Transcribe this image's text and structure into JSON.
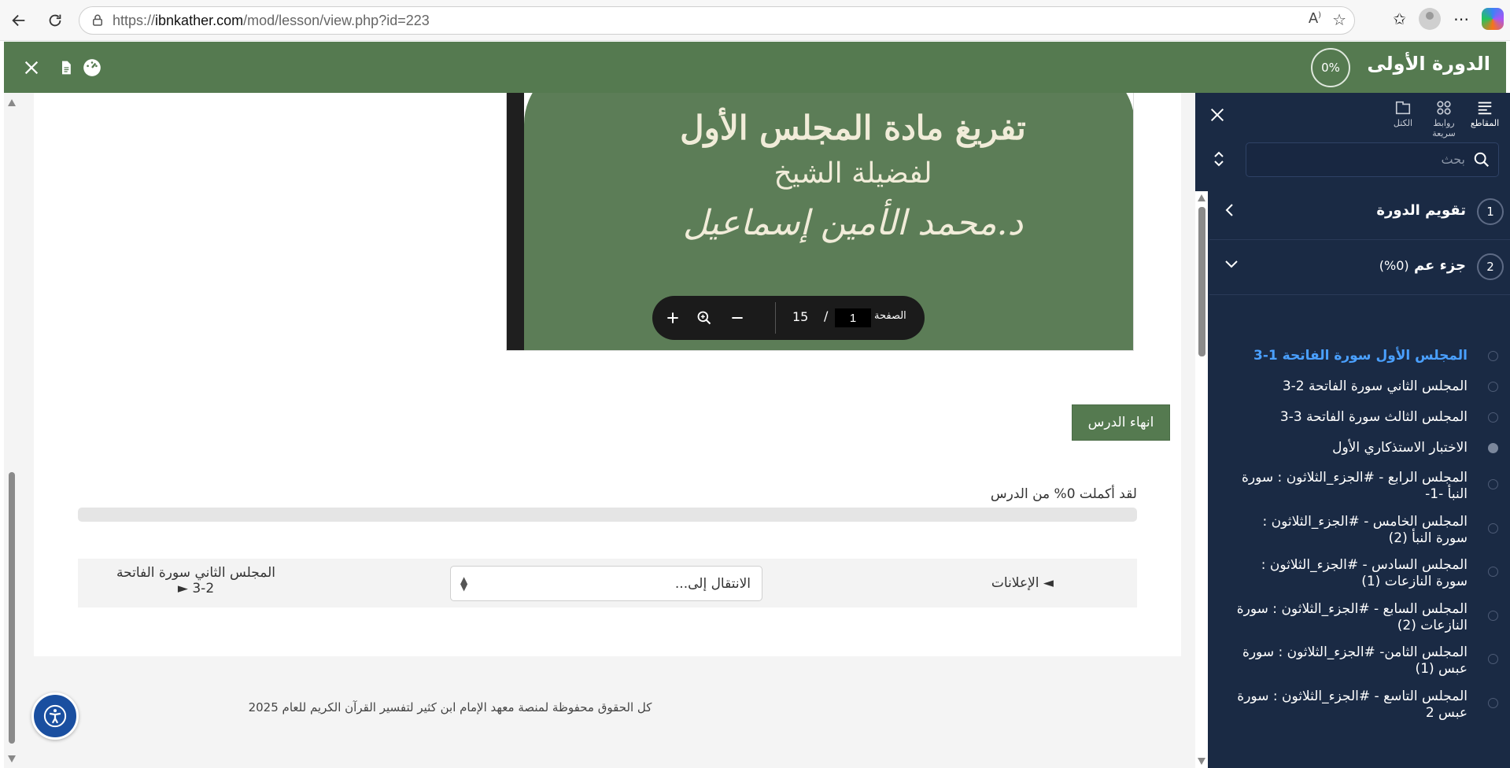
{
  "browser": {
    "url_prefix": "https://",
    "url_host": "ibnkather.com",
    "url_path": "/mod/lesson/view.php?id=223"
  },
  "header": {
    "course_title": "الدورة الأولى",
    "progress": "0%"
  },
  "pdf": {
    "line1": "تفريغ مادة المجلس الأول",
    "line2": "لفضيلة الشيخ",
    "line3": "د.محمد الأمين إسماعيل",
    "page_label": "الصفحة",
    "current_page": "1",
    "slash": "/",
    "total_pages": "15"
  },
  "lesson": {
    "finish_label": "انهاء الدرس",
    "completed_text": "لقد أكملت 0% من الدرس",
    "completed_percent": 0,
    "announcements_link": "◄ الإعلانات",
    "jump_placeholder": "الانتقال إلى...",
    "next_link": "المجلس الثاني سورة الفاتحة 2-3 ►"
  },
  "footer": {
    "copyright": "كل الحقوق محفوظة لمنصة معهد الإمام ابن كثير لتفسير القرآن الكريم للعام 2025"
  },
  "sidebar": {
    "tabs": [
      {
        "label": "المقاطع",
        "icon": "list-icon"
      },
      {
        "label": "روابط سريعة",
        "icon": "grid-icon"
      },
      {
        "label": "الكتل",
        "icon": "blocks-icon"
      }
    ],
    "search_placeholder": "بحث",
    "sections": [
      {
        "num": "1",
        "title": "تقويم الدورة"
      },
      {
        "num": "2",
        "title": "جزء عم",
        "progress": "(0%)"
      }
    ],
    "lessons": [
      {
        "title": "المجلس الأول سورة الفاتحة 1-3",
        "state": "active"
      },
      {
        "title": "المجلس الثاني سورة الفاتحة 2-3",
        "state": "todo"
      },
      {
        "title": "المجلس الثالث سورة الفاتحة 3-3",
        "state": "todo"
      },
      {
        "title": "الاختبار الاستذكاري الأول",
        "state": "done"
      },
      {
        "title": "المجلس الرابع - #الجزء_الثلاثون : سورة النبأ -1-",
        "state": "todo"
      },
      {
        "title": "المجلس الخامس - #الجزء_الثلاثون : سورة النبأ (2)",
        "state": "todo"
      },
      {
        "title": "المجلس السادس - #الجزء_الثلاثون : سورة النازعات (1)",
        "state": "todo"
      },
      {
        "title": "المجلس السابع - #الجزء_الثلاثون : سورة النازعات (2)",
        "state": "todo"
      },
      {
        "title": "المجلس الثامن- #الجزء_الثلاثون : سورة عبس (1)",
        "state": "todo"
      },
      {
        "title": "المجلس التاسع - #الجزء_الثلاثون : سورة عبس 2",
        "state": "todo"
      }
    ]
  }
}
